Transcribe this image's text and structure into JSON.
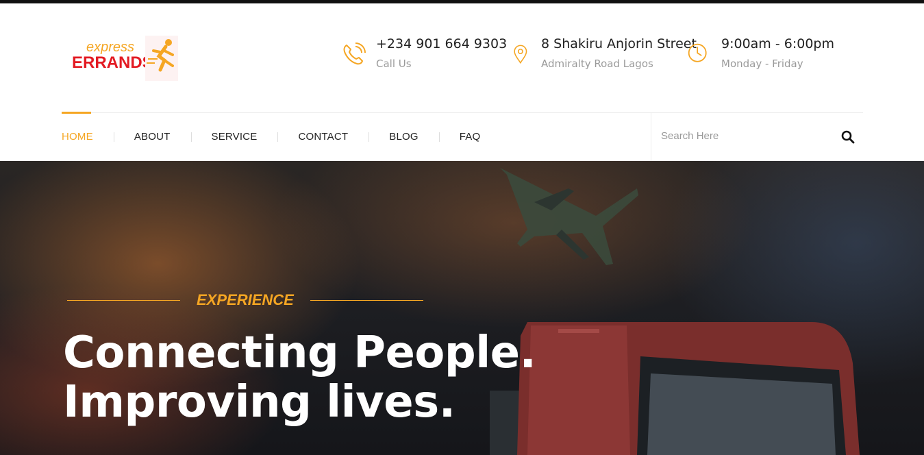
{
  "brand": {
    "line1": "express",
    "line2": "ERRANDS",
    "colors": {
      "accent": "#f5a623",
      "red": "#e31b23"
    }
  },
  "contact": [
    {
      "icon": "phone-icon",
      "main": "+234 901 664 9303",
      "sub": "Call Us"
    },
    {
      "icon": "location-pin-icon",
      "main": "8 Shakiru Anjorin Street",
      "sub": "Admiralty Road Lagos"
    },
    {
      "icon": "clock-icon",
      "main": "9:00am - 6:00pm",
      "sub": "Monday - Friday"
    }
  ],
  "nav": {
    "items": [
      {
        "label": "HOME",
        "active": true
      },
      {
        "label": "ABOUT"
      },
      {
        "label": "SERVICE"
      },
      {
        "label": "CONTACT"
      },
      {
        "label": "BLOG"
      },
      {
        "label": "FAQ"
      }
    ],
    "search": {
      "placeholder": "Search Here",
      "icon": "search-icon"
    }
  },
  "hero": {
    "kicker": "EXPERIENCE",
    "headline_line1": "Connecting People.",
    "headline_line2": "Improving lives."
  }
}
